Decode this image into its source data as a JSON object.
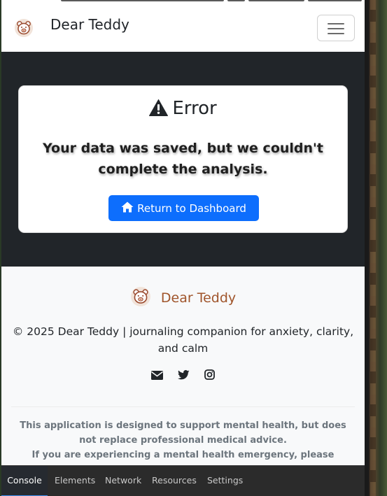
{
  "navbar": {
    "brand": "Dear Teddy",
    "brand_icon": "teddy-bear-logo-icon",
    "toggler_icon": "hamburger-menu-icon"
  },
  "error": {
    "title": "Error",
    "title_icon": "warning-triangle-icon",
    "message": "Your data was saved, but we couldn't complete the analysis.",
    "button_label": "Return to Dashboard",
    "button_icon": "home-icon"
  },
  "footer": {
    "brand": "Dear Teddy",
    "brand_icon": "teddy-bear-logo-icon",
    "copyright": "© 2025 Dear Teddy | journaling companion for anxiety, clarity, and calm",
    "social": [
      "envelope-icon",
      "twitter-icon",
      "instagram-icon"
    ],
    "disclaimer_line1": "This application is designed to support mental health, but does not replace professional medical advice.",
    "disclaimer_line2": "If you are experiencing a mental health emergency, please contact"
  },
  "devtools": {
    "tabs": [
      "Console",
      "Elements",
      "Network",
      "Resources",
      "Settings"
    ],
    "active_tab": "Console"
  },
  "colors": {
    "primary": "#0d6efd",
    "brand_accent": "#a0552b",
    "page_dark": "#212529",
    "footer_bg": "#f8f9fa"
  }
}
